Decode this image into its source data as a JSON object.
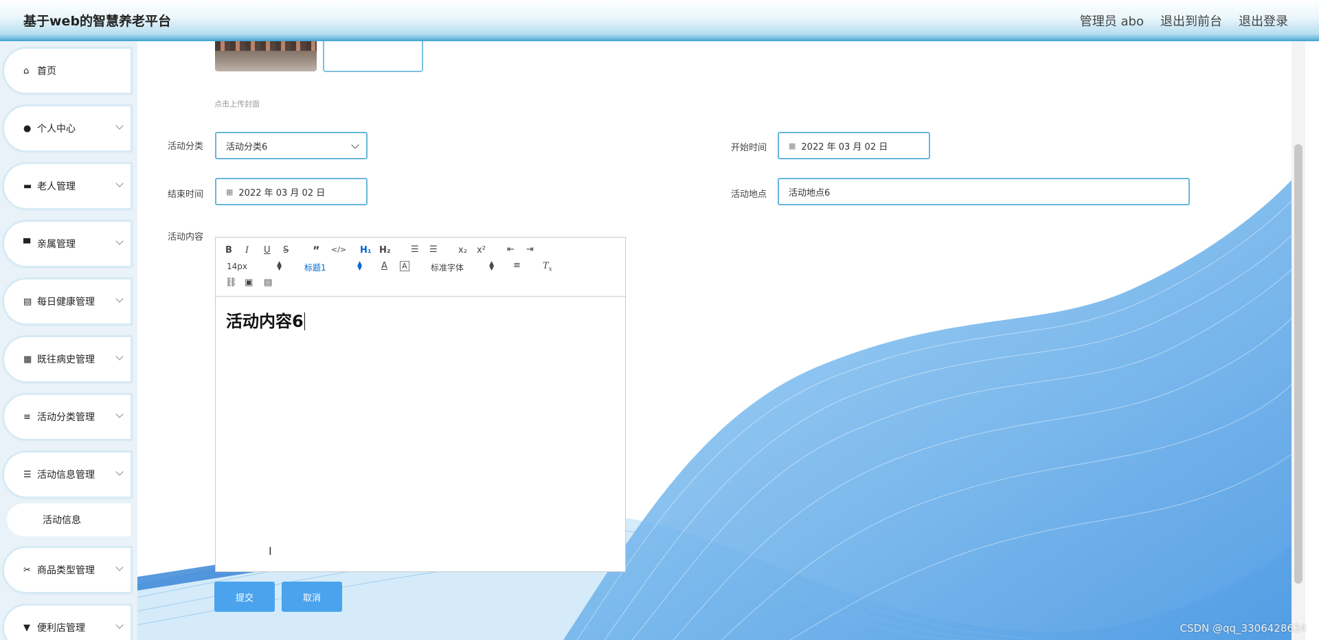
{
  "header": {
    "title": "基于web的智慧养老平台",
    "admin": "管理员 abo",
    "to_frontend": "退出到前台",
    "logout": "退出登录"
  },
  "sidebar": {
    "items": [
      {
        "label": "首页",
        "icon": "home-icon",
        "glyph": "⌂"
      },
      {
        "label": "个人中心",
        "icon": "user-icon",
        "glyph": "●"
      },
      {
        "label": "老人管理",
        "icon": "briefcase-icon",
        "glyph": "▬"
      },
      {
        "label": "亲属管理",
        "icon": "tray-icon",
        "glyph": "▀"
      },
      {
        "label": "每日健康管理",
        "icon": "clipboard-icon",
        "glyph": "▤"
      },
      {
        "label": "既往病史管理",
        "icon": "grid-icon",
        "glyph": "▦"
      },
      {
        "label": "活动分类管理",
        "icon": "list-icon",
        "glyph": "≡"
      },
      {
        "label": "活动信息管理",
        "icon": "sliders-icon",
        "glyph": "☰"
      },
      {
        "label": "商品类型管理",
        "icon": "ticket-icon",
        "glyph": "✂"
      },
      {
        "label": "便利店管理",
        "icon": "store-icon",
        "glyph": "▼"
      }
    ],
    "sub_item": "活动信息"
  },
  "form": {
    "upload_hint": "点击上传封面",
    "category_label": "活动分类",
    "category_value": "活动分类6",
    "start_label": "开始时间",
    "start_value": "2022 年 03 月 02 日",
    "end_label": "结束时间",
    "end_value": "2022 年 03 月 02 日",
    "place_label": "活动地点",
    "place_value": "活动地点6",
    "content_label": "活动内容",
    "content_value": "活动内容6",
    "submit": "提交",
    "cancel": "取消"
  },
  "editor": {
    "font_size": "14px",
    "heading": "标题1",
    "font_family": "标准字体"
  },
  "watermark": "CSDN @qq_3306428634"
}
